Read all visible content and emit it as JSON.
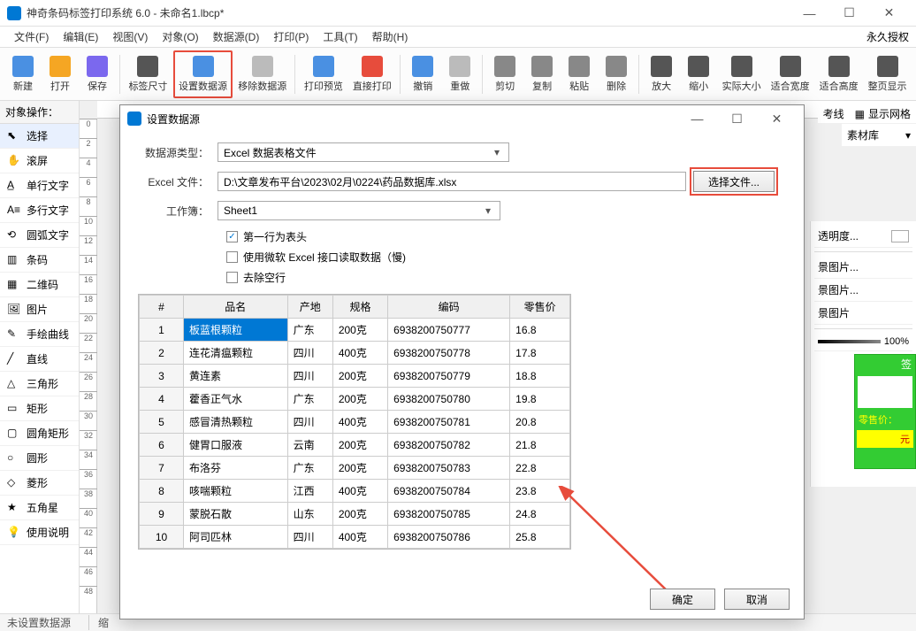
{
  "window": {
    "title": "神奇条码标签打印系统 6.0 - 未命名1.lbcp*",
    "license": "永久授权"
  },
  "menu": [
    "文件(F)",
    "编辑(E)",
    "视图(V)",
    "对象(O)",
    "数据源(D)",
    "打印(P)",
    "工具(T)",
    "帮助(H)"
  ],
  "toolbar": [
    {
      "label": "新建",
      "icon": "#4a90e2"
    },
    {
      "label": "打开",
      "icon": "#f5a623"
    },
    {
      "label": "保存",
      "icon": "#7b68ee"
    },
    {
      "sep": true
    },
    {
      "label": "标签尺寸",
      "icon": "#555"
    },
    {
      "label": "设置数据源",
      "icon": "#4a90e2",
      "hl": true
    },
    {
      "label": "移除数据源",
      "icon": "#bbb"
    },
    {
      "sep": true
    },
    {
      "label": "打印预览",
      "icon": "#4a90e2"
    },
    {
      "label": "直接打印",
      "icon": "#e74c3c"
    },
    {
      "sep": true
    },
    {
      "label": "撤销",
      "icon": "#4a90e2"
    },
    {
      "label": "重做",
      "icon": "#bbb"
    },
    {
      "sep": true
    },
    {
      "label": "剪切",
      "icon": "#888"
    },
    {
      "label": "复制",
      "icon": "#888"
    },
    {
      "label": "粘贴",
      "icon": "#888"
    },
    {
      "label": "删除",
      "icon": "#888"
    },
    {
      "sep": true
    },
    {
      "label": "放大",
      "icon": "#555"
    },
    {
      "label": "缩小",
      "icon": "#555"
    },
    {
      "label": "实际大小",
      "icon": "#555"
    },
    {
      "label": "适合宽度",
      "icon": "#555"
    },
    {
      "label": "适合高度",
      "icon": "#555"
    },
    {
      "label": "整页显示",
      "icon": "#555"
    }
  ],
  "left_header": "对象操作：",
  "left_items": [
    {
      "label": "选择",
      "sel": true
    },
    {
      "label": "滚屏"
    },
    {
      "label": "单行文字"
    },
    {
      "label": "多行文字"
    },
    {
      "label": "圆弧文字"
    },
    {
      "label": "条码"
    },
    {
      "label": "二维码"
    },
    {
      "label": "图片"
    },
    {
      "label": "手绘曲线"
    },
    {
      "label": "直线"
    },
    {
      "label": "三角形"
    },
    {
      "label": "矩形"
    },
    {
      "label": "圆角矩形"
    },
    {
      "label": "圆形"
    },
    {
      "label": "菱形"
    },
    {
      "label": "五角星"
    },
    {
      "label": "使用说明"
    }
  ],
  "ruler_v": [
    "0",
    "2",
    "4",
    "6",
    "8",
    "10",
    "12",
    "14",
    "16",
    "18",
    "20",
    "22",
    "24",
    "26",
    "28",
    "30",
    "32",
    "34",
    "36",
    "38",
    "40",
    "42",
    "44",
    "46",
    "48"
  ],
  "right": {
    "ref_line": "考线",
    "show_grid": "显示网格",
    "material": "素材库",
    "opacity": "透明度...",
    "bg1": "景图片...",
    "bg2": "景图片...",
    "bg3": "景图片",
    "slider_pct": "100%"
  },
  "status": {
    "left": "未设置数据源",
    "zoom": "缩"
  },
  "dialog": {
    "title": "设置数据源",
    "labels": {
      "type": "数据源类型：",
      "file": "Excel 文件：",
      "sheet": "工作簿："
    },
    "type_value": "Excel 数据表格文件",
    "file_value": "D:\\文章发布平台\\2023\\02月\\0224\\药品数据库.xlsx",
    "browse": "选择文件...",
    "sheet_value": "Sheet1",
    "checks": {
      "first_row": "第一行为表头",
      "use_ms": "使用微软 Excel 接口读取数据（慢)",
      "remove_blank": "去除空行"
    },
    "grid_headers": [
      "#",
      "品名",
      "产地",
      "规格",
      "编码",
      "零售价"
    ],
    "grid_rows": [
      [
        "1",
        "板蓝根颗粒",
        "广东",
        "200克",
        "6938200750777",
        "16.8"
      ],
      [
        "2",
        "连花清瘟颗粒",
        "四川",
        "400克",
        "6938200750778",
        "17.8"
      ],
      [
        "3",
        "黄连素",
        "四川",
        "200克",
        "6938200750779",
        "18.8"
      ],
      [
        "4",
        "藿香正气水",
        "广东",
        "200克",
        "6938200750780",
        "19.8"
      ],
      [
        "5",
        "感冒清热颗粒",
        "四川",
        "400克",
        "6938200750781",
        "20.8"
      ],
      [
        "6",
        "健胃口服液",
        "云南",
        "200克",
        "6938200750782",
        "21.8"
      ],
      [
        "7",
        "布洛芬",
        "广东",
        "200克",
        "6938200750783",
        "22.8"
      ],
      [
        "8",
        "咳喘颗粒",
        "江西",
        "400克",
        "6938200750784",
        "23.8"
      ],
      [
        "9",
        "蒙脱石散",
        "山东",
        "200克",
        "6938200750785",
        "24.8"
      ],
      [
        "10",
        "阿司匹林",
        "四川",
        "400克",
        "6938200750786",
        "25.8"
      ]
    ],
    "ok": "确定",
    "cancel": "取消"
  },
  "preview": {
    "tag": "签",
    "price_label": "零售价：",
    "unit": "元"
  }
}
